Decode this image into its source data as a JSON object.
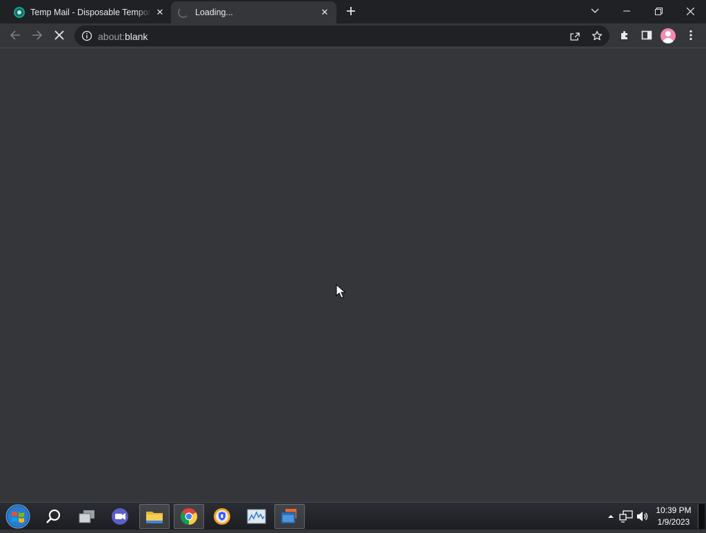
{
  "browser": {
    "tabs": [
      {
        "title": "Temp Mail - Disposable Temporary Email",
        "state": "inactive",
        "icon": "tempmail-favicon-icon"
      },
      {
        "title": "Loading...",
        "state": "active",
        "icon": "loading-spinner-icon"
      }
    ],
    "new_tab_icon": "plus-icon",
    "window_controls": [
      "tab-search-icon",
      "minimize-icon",
      "restore-icon",
      "close-icon"
    ],
    "url_scheme": "about:",
    "url_path": "blank",
    "toolbar_icons": [
      "back-arrow-icon",
      "forward-arrow-icon",
      "stop-loading-icon",
      "info-icon",
      "share-icon",
      "star-icon",
      "extensions-icon",
      "side-panel-icon",
      "profile-avatar-icon",
      "kebab-menu-icon"
    ]
  },
  "taskbar": {
    "apps": [
      "file-explorer-icon",
      "chrome-icon",
      "vpn-shield-icon",
      "resource-monitor-icon",
      "app-window-icon"
    ],
    "pinned": [
      "search-icon",
      "task-view-icon",
      "meet-chat-icon"
    ],
    "clock_time": "10:39 PM",
    "clock_date": "1/9/2023"
  },
  "colors": {
    "tabstrip_bg": "#202124",
    "toolbar_bg": "#35363a",
    "omnibox_bg": "#202124",
    "avatar_color": "#f08ab4"
  }
}
